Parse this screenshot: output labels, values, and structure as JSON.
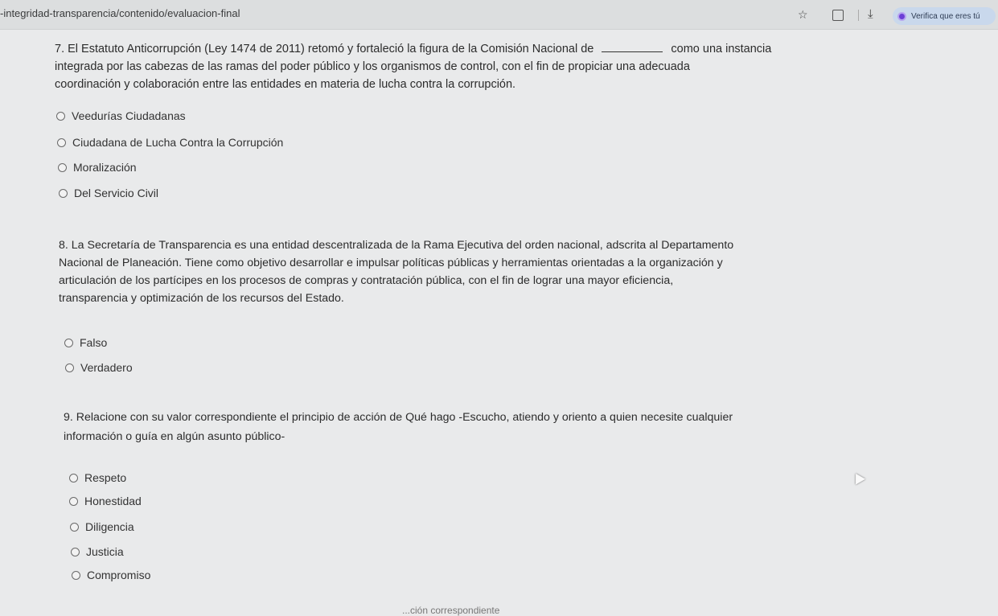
{
  "browser": {
    "url": "-integridad-transparencia/contenido/evaluacion-final",
    "star_icon": "star-icon",
    "share_icon": "share-icon",
    "download_icon": "download-icon",
    "verify_label": "Verifica que eres tú"
  },
  "questions": [
    {
      "lines": [
        "7. El Estatuto Anticorrupción (Ley 1474 de 2011) retomó y fortaleció la figura de la Comisión Nacional de",
        "como una instancia",
        "integrada por las cabezas de las ramas del poder público y los organismos de control, con el fin de propiciar una adecuada",
        "coordinación y colaboración entre las entidades en materia de lucha contra la corrupción."
      ],
      "options": [
        "Veedurías Ciudadanas",
        "Ciudadana de Lucha Contra la Corrupción",
        "Moralización",
        "Del Servicio Civil"
      ]
    },
    {
      "lines": [
        "8. La Secretaría de Transparencia es una entidad descentralizada de la Rama Ejecutiva del orden nacional, adscrita al Departamento",
        "Nacional de Planeación. Tiene como objetivo desarrollar e impulsar políticas públicas y herramientas orientadas a la organización y",
        "articulación de los partícipes en los procesos de compras y contratación pública, con el fin de lograr una mayor eficiencia,",
        "transparencia y optimización de los recursos del Estado."
      ],
      "options": [
        "Falso",
        "Verdadero"
      ]
    },
    {
      "lines": [
        "9. Relacione con su valor correspondiente el principio de acción de Qué hago -Escucho, atiendo y oriento a quien necesite cualquier",
        "información o guía en algún asunto público-"
      ],
      "options": [
        "Respeto",
        "Honestidad",
        "Diligencia",
        "Justicia",
        "Compromiso"
      ]
    }
  ],
  "footer_partial": "...ción correspondiente"
}
